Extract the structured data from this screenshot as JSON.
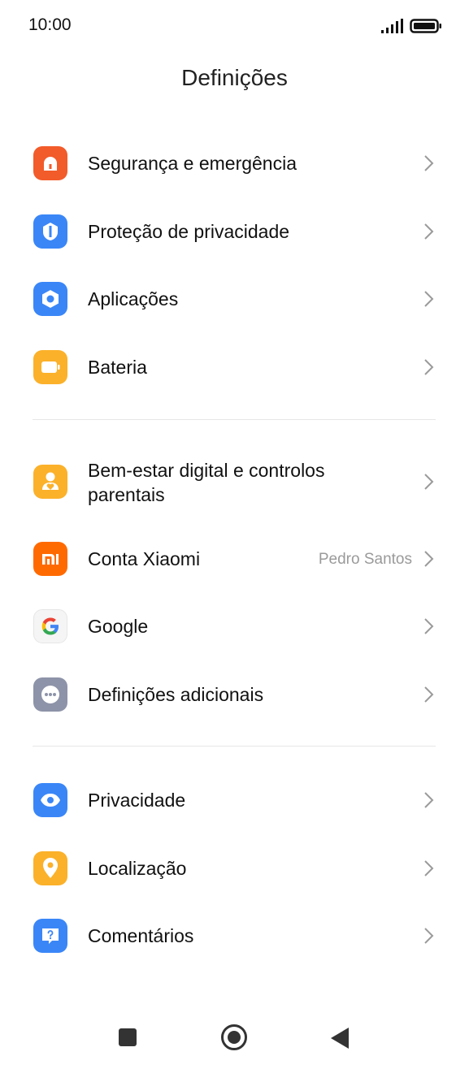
{
  "status_bar": {
    "time": "10:00",
    "signal_icon": "signal-icon",
    "battery_icon": "battery-icon"
  },
  "header": {
    "title": "Definições"
  },
  "sections": [
    {
      "items": [
        {
          "id": "security",
          "label": "Segurança e emergência",
          "icon": "alarm-icon",
          "icon_color": "#f25b2a"
        },
        {
          "id": "privacy-protection",
          "label": "Proteção de privacidade",
          "icon": "shield-icon",
          "icon_color": "#3a86f7"
        },
        {
          "id": "apps",
          "label": "Aplicações",
          "icon": "hexagon-icon",
          "icon_color": "#3a86f7"
        },
        {
          "id": "battery",
          "label": "Bateria",
          "icon": "battery-settings-icon",
          "icon_color": "#fbb12a"
        }
      ]
    },
    {
      "items": [
        {
          "id": "wellbeing",
          "label_line1": "Bem-estar digital e controlos",
          "label_line2": "parentais",
          "icon": "person-heart-icon",
          "icon_color": "#fbb12a"
        },
        {
          "id": "xiaomi-account",
          "label": "Conta Xiaomi",
          "value": "Pedro Santos",
          "icon": "mi-logo-icon",
          "icon_color": "#ff6a00"
        },
        {
          "id": "google",
          "label": "Google",
          "icon": "google-g-icon",
          "icon_color": "#f5f5f5"
        },
        {
          "id": "additional",
          "label": "Definições adicionais",
          "icon": "more-dots-icon",
          "icon_color": "#8d93a8"
        }
      ]
    },
    {
      "items": [
        {
          "id": "privacy",
          "label": "Privacidade",
          "icon": "eye-icon",
          "icon_color": "#3a86f7"
        },
        {
          "id": "location",
          "label": "Localização",
          "icon": "location-pin-icon",
          "icon_color": "#fbb12a"
        },
        {
          "id": "feedback",
          "label": "Comentários",
          "icon": "feedback-question-icon",
          "icon_color": "#3a86f7"
        }
      ]
    }
  ],
  "nav_bar": {
    "recents": "recents-icon",
    "home": "home-icon",
    "back": "back-icon"
  }
}
